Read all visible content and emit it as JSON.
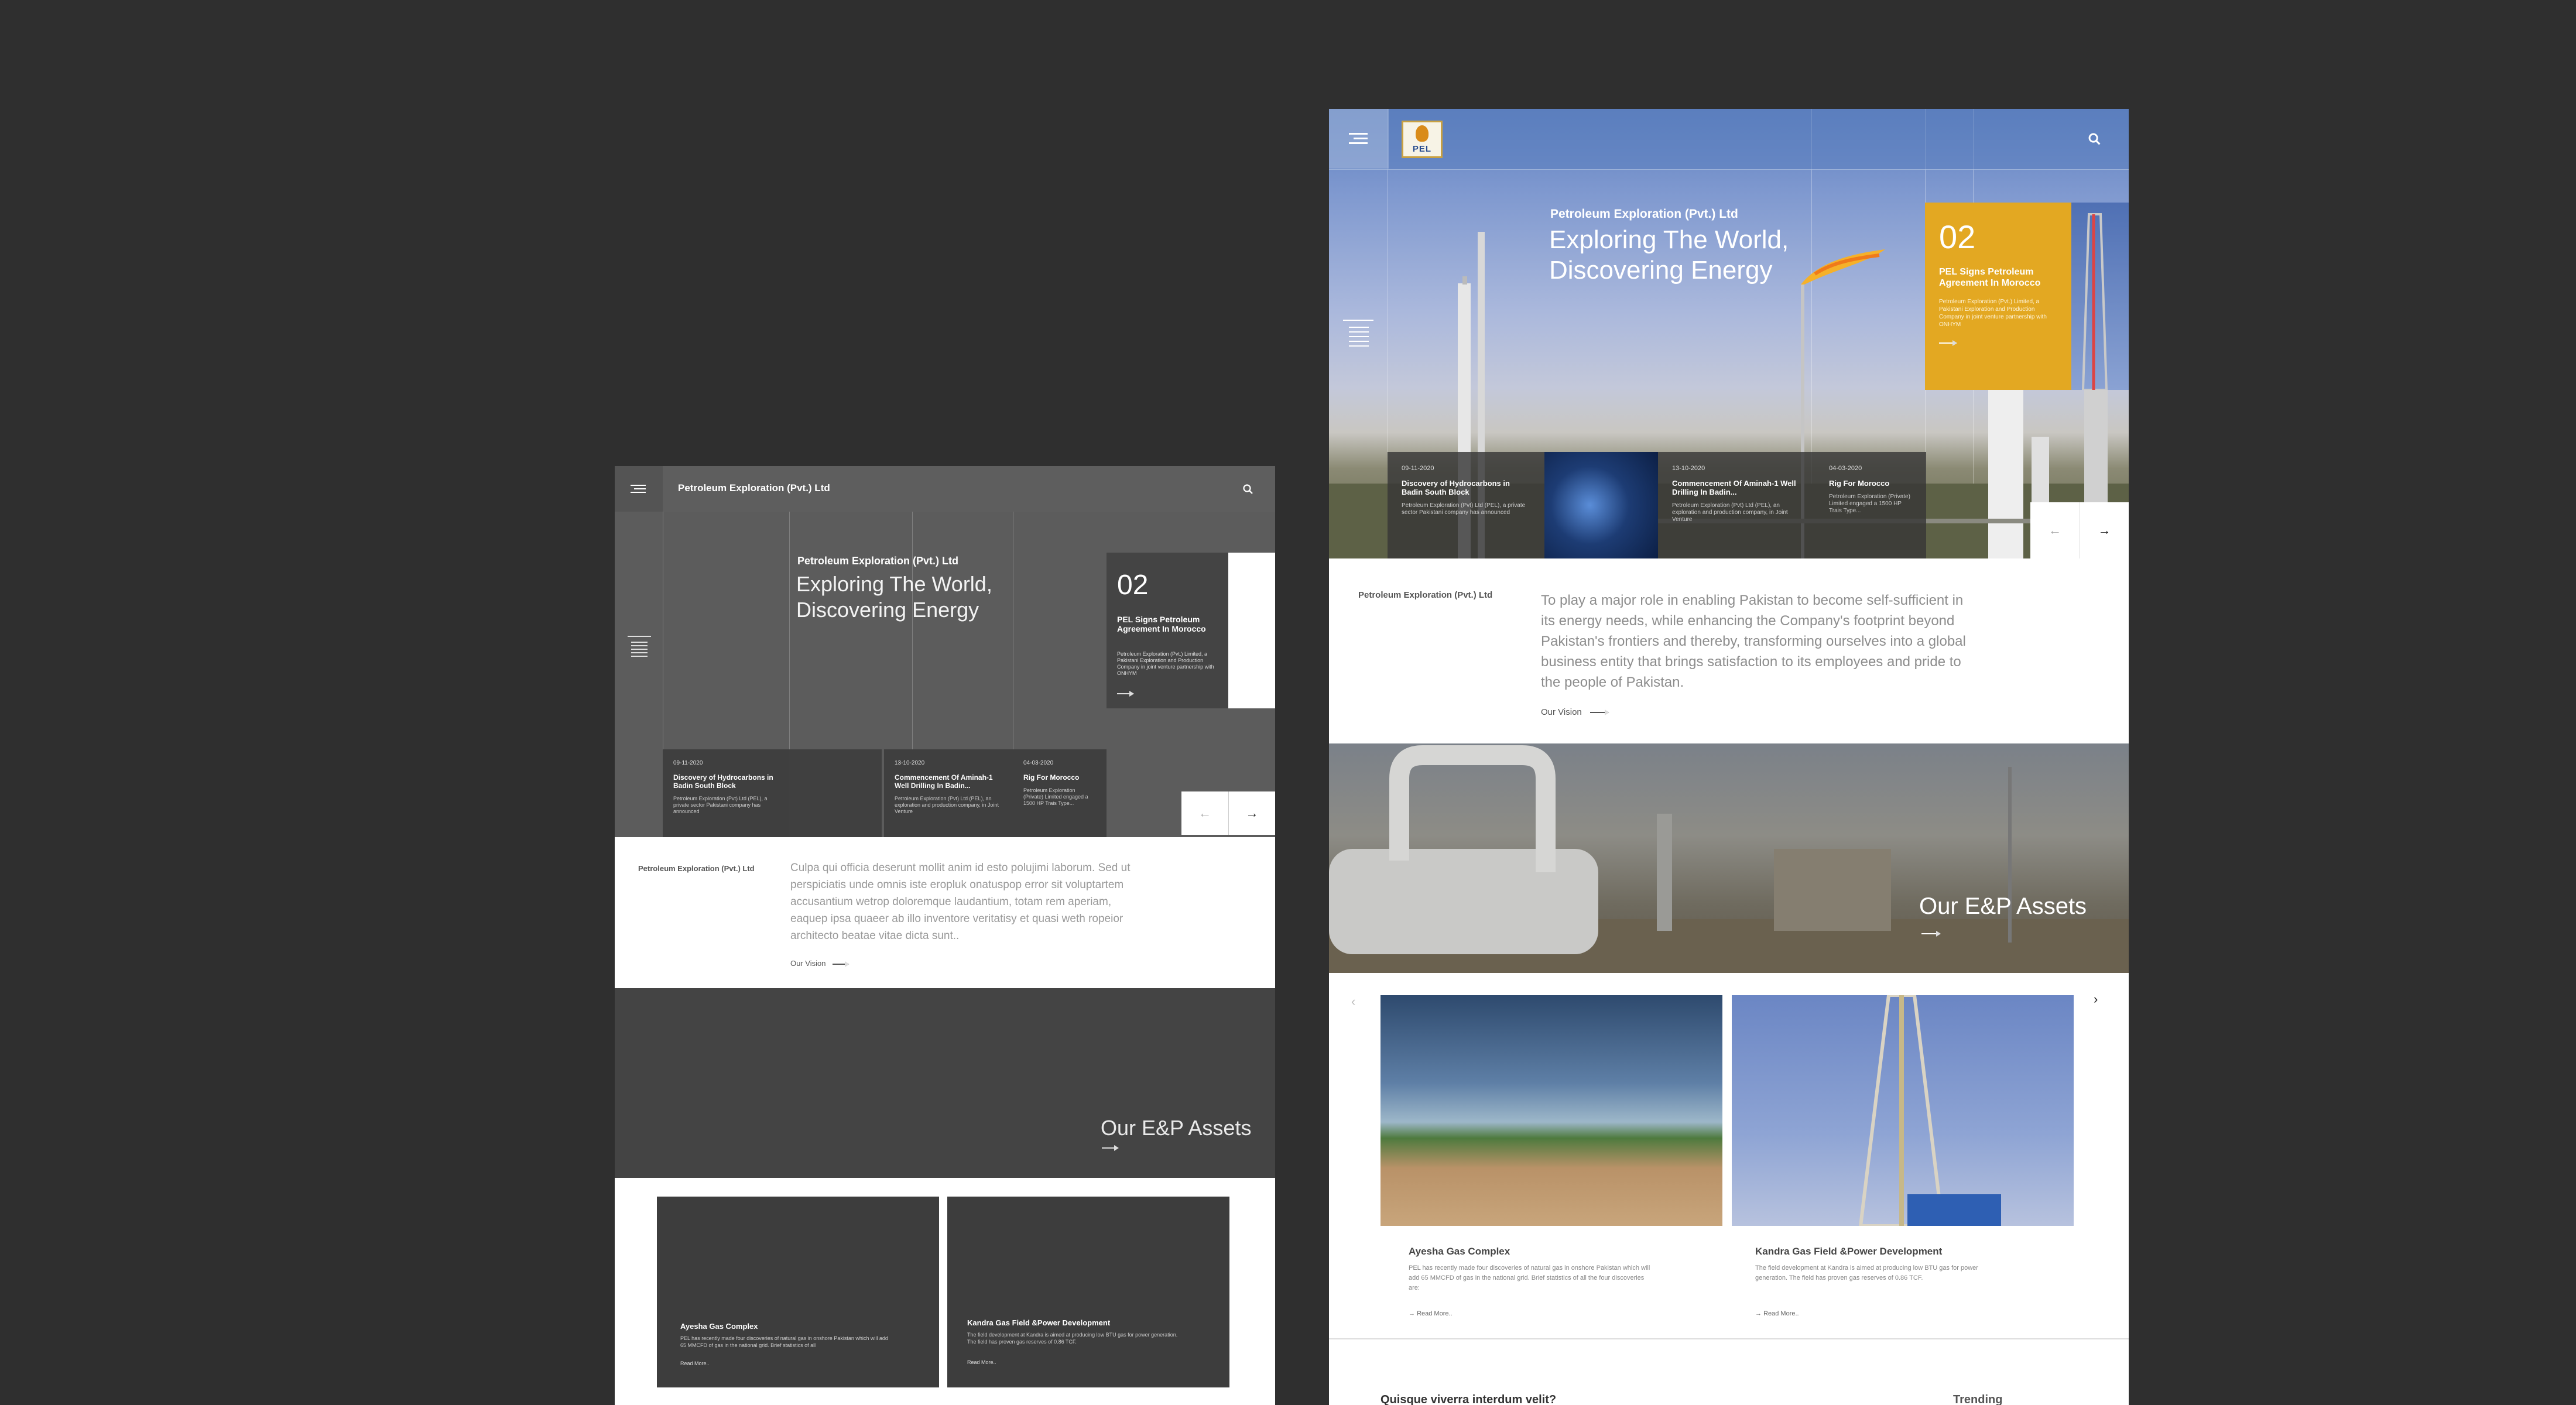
{
  "wireframe": {
    "header_title": "Petroleum Exploration (Pvt.) Ltd",
    "hero_eyebrow": "Petroleum Exploration (Pvt.) Ltd",
    "hero_title": "Exploring The World, Discovering Energy",
    "slide": {
      "number": "02",
      "title": "PEL Signs Petroleum Agreement In Morocco",
      "text": "Petroleum Exploration (Pvt.) Limited, a Pakistani Exploration and Production Company in joint venture partnership with ONHYM"
    },
    "news": [
      {
        "date": "09-11-2020",
        "title": "Discovery of Hydrocarbons in Badin South Block",
        "text": "Petroleum Exploration (Pvt) Ltd (PEL), a private sector Pakistani company has announced"
      },
      {
        "date": "13-10-2020",
        "title": "Commencement Of Aminah-1 Well Drilling In Badin...",
        "text": "Petroleum Exploration (Pvt) Ltd (PEL), an exploration and production company, in Joint Venture"
      },
      {
        "date": "04-03-2020",
        "title": "Rig For Morocco",
        "text": "Petroleum Exploration (Private) Limited engaged a 1500 HP Trais Type..."
      }
    ],
    "nav_prev": "←",
    "nav_next": "→",
    "about_label": "Petroleum Exploration (Pvt.) Ltd",
    "about_text": "Culpa qui officia deserunt mollit anim id esto polujimi laborum. Sed ut perspiciatis unde omnis iste eropluk onatuspop error sit voluptartem accusantium wetrop doloremque laudantium, totam rem aperiam, eaquep ipsa quaeer ab illo inventore veritatisy et quasi weth ropeior architecto beatae vitae dicta sunt..",
    "vision_link": "Our Vision",
    "assets_title": "Our E&P Assets",
    "assets": [
      {
        "name": "Ayesha Gas Complex",
        "text": "PEL has recently made four discoveries of natural gas in onshore Pakistan which will add 65 MMCFD of gas in the national grid. Brief statistics of all",
        "read": "Read More.."
      },
      {
        "name": "Kandra Gas Field &Power Development",
        "text": "The field development at Kandra is aimed at producing low BTU gas for power generation. The field has proven gas reserves of 0.86 TCF.",
        "read": "Read More.."
      }
    ]
  },
  "full": {
    "logo_text": "PEL",
    "hero_eyebrow": "Petroleum Exploration (Pvt.) Ltd",
    "hero_title": "Exploring The World, Discovering Energy",
    "slide": {
      "number": "02",
      "title": "PEL Signs Petroleum Agreement In Morocco",
      "text": "Petroleum Exploration (Pvt.) Limited, a Pakistani Exploration and Production Company in joint venture partnership with ONHYM"
    },
    "news": [
      {
        "date": "09-11-2020",
        "title": "Discovery of Hydrocarbons in Badin South Block",
        "text": "Petroleum Exploration (Pvt) Ltd (PEL), a private sector Pakistani company has announced"
      },
      {
        "date": "13-10-2020",
        "title": "Commencement Of Aminah-1 Well Drilling In Badin...",
        "text": "Petroleum Exploration (Pvt) Ltd (PEL), an exploration and production company, in Joint Venture"
      },
      {
        "date": "04-03-2020",
        "title": "Rig For Morocco",
        "text": "Petroleum Exploration (Private) Limited engaged a 1500 HP Trais Type..."
      }
    ],
    "nav_prev": "←",
    "nav_next": "→",
    "about_label": "Petroleum Exploration (Pvt.) Ltd",
    "about_text": "To play a major role in enabling Pakistan to become self-sufficient in its energy needs, while enhancing the Company's footprint beyond Pakistan's frontiers and thereby, transforming ourselves into a global business entity that brings satisfaction to its employees and pride to the people of Pakistan.",
    "vision_link": "Our Vision",
    "assets_title": "Our E&P Assets",
    "carousel_prev": "‹",
    "carousel_next": "›",
    "assets": [
      {
        "name": "Ayesha Gas Complex",
        "text": "PEL has recently made four discoveries of natural gas in onshore Pakistan which will add 65 MMCFD of gas in the national grid. Brief statistics of all the four discoveries are:",
        "read": "Read More.."
      },
      {
        "name": "Kandra Gas Field &Power Development",
        "text": "The field development at Kandra is aimed at producing low BTU gas for power generation. The field has proven gas reserves of 0.86 TCF.",
        "read": "Read More.."
      }
    ],
    "footer_question": "Quisque viverra interdum velit?",
    "footer_trending": "Trending"
  },
  "colors": {
    "background": "#2f2f2f",
    "wire_dark": "#444444",
    "accent_gold": "#e3a822",
    "hero_blue": "#5d7fbe"
  },
  "icons": [
    "hamburger-menu-icon",
    "search-icon",
    "arrow-left-icon",
    "arrow-right-icon",
    "chevron-left-icon",
    "chevron-right-icon",
    "long-arrow-icon"
  ]
}
